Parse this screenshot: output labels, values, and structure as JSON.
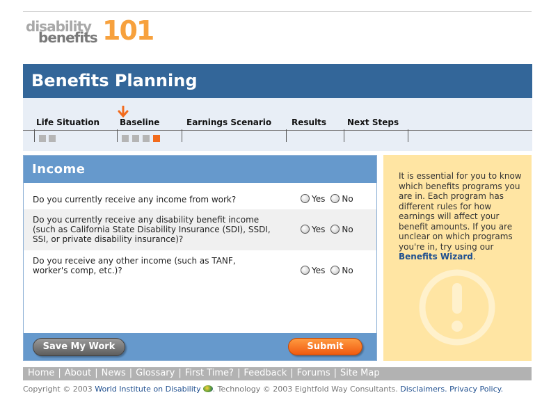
{
  "logo": {
    "word1": "disability",
    "word2": "benefits",
    "number": "101"
  },
  "page_title": "Benefits Planning",
  "steps": [
    {
      "label": "Life Situation"
    },
    {
      "label": "Baseline"
    },
    {
      "label": "Earnings Scenario"
    },
    {
      "label": "Results"
    },
    {
      "label": "Next Steps"
    }
  ],
  "current_step": "Baseline",
  "income": {
    "heading": "Income",
    "questions": [
      {
        "text": "Do you currently receive any income from work?",
        "yes": "Yes",
        "no": "No"
      },
      {
        "text": "Do you currently receive any disability benefit income (such as California State Disability Insurance (SDI), SSDI, SSI, or private disability insurance)?",
        "yes": "Yes",
        "no": "No"
      },
      {
        "text": "Do you receive any other income (such as TANF, worker's comp, etc.)?",
        "yes": "Yes",
        "no": "No"
      }
    ],
    "save_label": "Save My Work",
    "submit_label": "Submit"
  },
  "tip": {
    "text": "It is essential for you to know which benefits programs you are in. Each program has different rules for how earnings will affect your benefit amounts. If you are unclear on which programs you're in, try using our",
    "link": "Benefits Wizard",
    "end": "."
  },
  "nav": [
    "Home",
    "About",
    "News",
    "Glossary",
    "First Time?",
    "Feedback",
    "Forums",
    "Site Map"
  ],
  "footer": {
    "copyright": "Copyright © 2003",
    "org": "World Institute on Disability",
    "tech": ". Technology © 2003 Eightfold Way Consultants.",
    "disclaimers": "Disclaimers",
    "privacy": "Privacy Policy"
  },
  "colors": {
    "title_bar": "#336699",
    "panel_header": "#6699cc",
    "accent": "#f26b1d",
    "tip_bg": "#ffe5a3"
  }
}
